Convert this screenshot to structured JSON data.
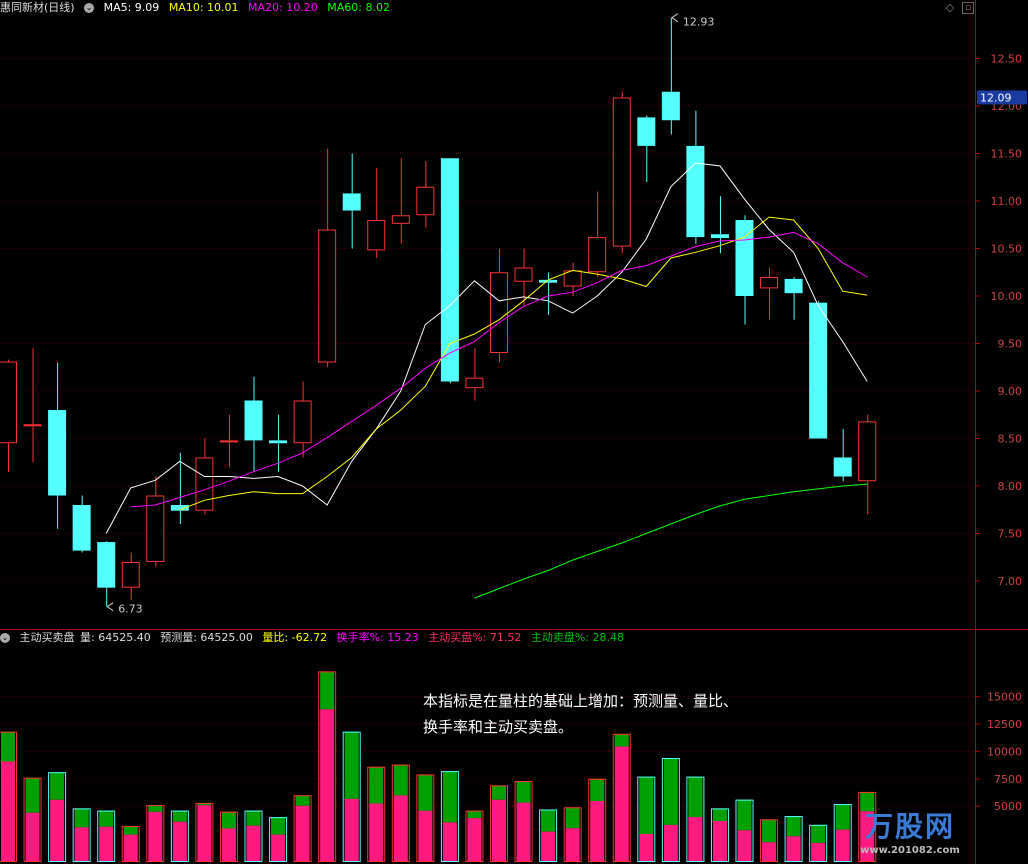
{
  "header": {
    "stock_name": "惠同新材(日线)",
    "ma5": "MA5: 9.09",
    "ma10": "MA10: 10.01",
    "ma20": "MA20: 10.20",
    "ma60": "MA60: 8.02"
  },
  "vol_header": {
    "name": "主动买卖盘",
    "vol": "量: 64525.40",
    "pred": "预测量: 64525.00",
    "ratio": "量比: -62.72",
    "turnover": "换手率%: 15.23",
    "buy": "主动买盘%: 71.52",
    "sell": "主动卖盘%: 28.48"
  },
  "annotation": {
    "line1": "本指标是在量柱的基础上增加：预测量、量比、",
    "line2": "换手率和主动买卖盘。"
  },
  "watermark": {
    "name": "万股网",
    "url": "www.201082.com"
  },
  "colors": {
    "up": "#ff3232",
    "down": "#54ffff",
    "ma5": "#ffffff",
    "ma10": "#ffff00",
    "ma20": "#ff00ff",
    "ma60": "#00ff00",
    "buy": "#ff1a80",
    "sell": "#00a000",
    "axis": "#b00000"
  },
  "chart_data": [
    {
      "type": "candlestick",
      "y_ticks": [
        7.0,
        7.5,
        8.0,
        8.5,
        9.0,
        9.5,
        10.0,
        10.5,
        11.0,
        11.5,
        12.0,
        12.5
      ],
      "ylim": [
        6.62,
        13.05
      ],
      "current_price": "12.09",
      "high_label": "12.93",
      "low_label": "6.73",
      "candles": [
        {
          "o": 8.45,
          "h": 9.33,
          "l": 8.15,
          "c": 9.31
        },
        {
          "o": 8.65,
          "h": 9.45,
          "l": 8.25,
          "c": 8.65
        },
        {
          "o": 8.8,
          "h": 9.3,
          "l": 7.55,
          "c": 7.9
        },
        {
          "o": 7.8,
          "h": 7.9,
          "l": 7.3,
          "c": 7.32
        },
        {
          "o": 7.41,
          "h": 7.42,
          "l": 6.73,
          "c": 6.93
        },
        {
          "o": 6.93,
          "h": 7.3,
          "l": 6.8,
          "c": 7.2
        },
        {
          "o": 7.2,
          "h": 8.1,
          "l": 7.15,
          "c": 7.9
        },
        {
          "o": 7.8,
          "h": 8.35,
          "l": 7.6,
          "c": 7.74
        },
        {
          "o": 7.74,
          "h": 8.5,
          "l": 7.7,
          "c": 8.3
        },
        {
          "o": 8.48,
          "h": 8.75,
          "l": 8.2,
          "c": 8.48
        },
        {
          "o": 8.9,
          "h": 9.15,
          "l": 8.15,
          "c": 8.48
        },
        {
          "o": 8.48,
          "h": 8.75,
          "l": 8.15,
          "c": 8.45
        },
        {
          "o": 8.45,
          "h": 9.1,
          "l": 8.3,
          "c": 8.9
        },
        {
          "o": 9.3,
          "h": 11.55,
          "l": 9.25,
          "c": 10.7
        },
        {
          "o": 11.08,
          "h": 11.5,
          "l": 10.5,
          "c": 10.9
        },
        {
          "o": 10.48,
          "h": 11.35,
          "l": 10.4,
          "c": 10.8
        },
        {
          "o": 10.76,
          "h": 11.45,
          "l": 10.55,
          "c": 10.85
        },
        {
          "o": 10.85,
          "h": 11.42,
          "l": 10.72,
          "c": 11.15
        },
        {
          "o": 11.45,
          "h": 11.45,
          "l": 9.08,
          "c": 9.1
        },
        {
          "o": 9.03,
          "h": 9.45,
          "l": 8.9,
          "c": 9.14
        },
        {
          "o": 9.4,
          "h": 10.5,
          "l": 9.3,
          "c": 10.25
        },
        {
          "o": 10.15,
          "h": 10.5,
          "l": 9.9,
          "c": 10.3
        },
        {
          "o": 10.17,
          "h": 10.25,
          "l": 9.8,
          "c": 10.14
        },
        {
          "o": 10.1,
          "h": 10.35,
          "l": 10.0,
          "c": 10.27
        },
        {
          "o": 10.25,
          "h": 11.1,
          "l": 10.2,
          "c": 10.62
        },
        {
          "o": 10.52,
          "h": 12.15,
          "l": 10.45,
          "c": 12.09
        },
        {
          "o": 11.88,
          "h": 11.9,
          "l": 11.2,
          "c": 11.58
        },
        {
          "o": 12.15,
          "h": 12.93,
          "l": 11.7,
          "c": 11.85
        },
        {
          "o": 11.58,
          "h": 11.95,
          "l": 10.55,
          "c": 10.62
        },
        {
          "o": 10.65,
          "h": 11.05,
          "l": 10.45,
          "c": 10.61
        },
        {
          "o": 10.8,
          "h": 10.85,
          "l": 9.7,
          "c": 10.0
        },
        {
          "o": 10.08,
          "h": 10.3,
          "l": 9.75,
          "c": 10.2
        },
        {
          "o": 10.18,
          "h": 10.2,
          "l": 9.75,
          "c": 10.03
        },
        {
          "o": 9.93,
          "h": 9.95,
          "l": 8.5,
          "c": 8.5
        },
        {
          "o": 8.3,
          "h": 8.6,
          "l": 8.05,
          "c": 8.1
        },
        {
          "o": 8.05,
          "h": 8.75,
          "l": 7.7,
          "c": 8.68
        }
      ],
      "ma5": [
        null,
        null,
        null,
        null,
        7.5,
        7.98,
        8.06,
        8.26,
        8.1,
        8.1,
        8.08,
        8.1,
        8.0,
        7.8,
        8.26,
        8.6,
        9.0,
        9.7,
        9.9,
        10.16,
        9.95,
        9.99,
        9.95,
        9.82,
        10.0,
        10.25,
        10.6,
        11.15,
        11.4,
        11.37,
        11.02,
        10.7,
        10.46,
        9.9,
        9.52,
        9.1
      ],
      "ma10": [
        null,
        null,
        null,
        null,
        null,
        null,
        null,
        7.75,
        7.85,
        7.9,
        7.94,
        7.92,
        7.92,
        8.1,
        8.3,
        8.6,
        8.8,
        9.05,
        9.5,
        9.6,
        9.75,
        9.95,
        10.17,
        10.27,
        10.23,
        10.18,
        10.1,
        10.4,
        10.46,
        10.53,
        10.62,
        10.83,
        10.8,
        10.5,
        10.05,
        10.01
      ],
      "ma20": [
        null,
        null,
        null,
        null,
        null,
        7.78,
        7.8,
        7.88,
        7.96,
        8.05,
        8.15,
        8.24,
        8.35,
        8.51,
        8.68,
        8.85,
        9.03,
        9.24,
        9.4,
        9.52,
        9.72,
        9.89,
        10.0,
        10.04,
        10.14,
        10.27,
        10.32,
        10.42,
        10.52,
        10.58,
        10.59,
        10.62,
        10.67,
        10.55,
        10.35,
        10.2
      ],
      "ma60": [
        null,
        null,
        null,
        null,
        null,
        null,
        null,
        null,
        null,
        null,
        null,
        null,
        null,
        null,
        null,
        null,
        null,
        null,
        null,
        6.82,
        6.92,
        7.02,
        7.11,
        7.22,
        7.31,
        7.4,
        7.5,
        7.6,
        7.7,
        7.79,
        7.86,
        7.9,
        7.94,
        7.97,
        8.0,
        8.02
      ]
    },
    {
      "type": "volume",
      "y_ticks": [
        5000,
        7500,
        10000,
        12500,
        15000
      ],
      "ylim": [
        0,
        17000
      ],
      "bars": [
        {
          "v": 11800,
          "buy": 0.77
        },
        {
          "v": 7600,
          "buy": 0.58
        },
        {
          "v": 8100,
          "buy": 0.69
        },
        {
          "v": 4800,
          "buy": 0.64
        },
        {
          "v": 4600,
          "buy": 0.68
        },
        {
          "v": 3200,
          "buy": 0.75
        },
        {
          "v": 5100,
          "buy": 0.88
        },
        {
          "v": 4600,
          "buy": 0.78
        },
        {
          "v": 5300,
          "buy": 0.96
        },
        {
          "v": 4500,
          "buy": 0.66
        },
        {
          "v": 4600,
          "buy": 0.7
        },
        {
          "v": 4000,
          "buy": 0.6
        },
        {
          "v": 6000,
          "buy": 0.84
        },
        {
          "v": 17300,
          "buy": 0.8
        },
        {
          "v": 11800,
          "buy": 0.48
        },
        {
          "v": 8600,
          "buy": 0.61
        },
        {
          "v": 8800,
          "buy": 0.68
        },
        {
          "v": 7900,
          "buy": 0.58
        },
        {
          "v": 8200,
          "buy": 0.43
        },
        {
          "v": 4600,
          "buy": 0.85
        },
        {
          "v": 6900,
          "buy": 0.81
        },
        {
          "v": 7300,
          "buy": 0.73
        },
        {
          "v": 4700,
          "buy": 0.57
        },
        {
          "v": 4900,
          "buy": 0.61
        },
        {
          "v": 7500,
          "buy": 0.73
        },
        {
          "v": 11600,
          "buy": 0.9
        },
        {
          "v": 7700,
          "buy": 0.32
        },
        {
          "v": 9400,
          "buy": 0.35
        },
        {
          "v": 7700,
          "buy": 0.52
        },
        {
          "v": 4800,
          "buy": 0.76
        },
        {
          "v": 5600,
          "buy": 0.5
        },
        {
          "v": 3800,
          "buy": 0.45
        },
        {
          "v": 4100,
          "buy": 0.55
        },
        {
          "v": 3300,
          "buy": 0.5
        },
        {
          "v": 5200,
          "buy": 0.55
        },
        {
          "v": 6300,
          "buy": 0.72
        }
      ]
    }
  ]
}
